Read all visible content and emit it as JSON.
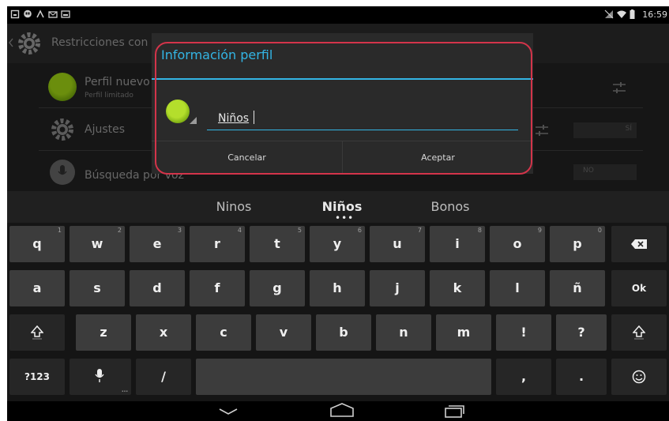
{
  "status_bar": {
    "time": "16:59"
  },
  "settings": {
    "title": "Restricciones con",
    "rows": [
      {
        "title": "Perfil nuevo",
        "subtitle": "Perfil limitado"
      },
      {
        "title": "Ajustes",
        "toggle": "SÍ"
      },
      {
        "title": "Búsqueda por voz",
        "toggle": "NO"
      }
    ]
  },
  "dialog": {
    "title": "Información perfil",
    "name_value": "Niños",
    "cancel_label": "Cancelar",
    "ok_label": "Aceptar"
  },
  "suggestions": {
    "left": "Ninos",
    "center": "Niños",
    "right": "Bonos"
  },
  "keyboard": {
    "row1": [
      {
        "label": "q",
        "hint": "1"
      },
      {
        "label": "w",
        "hint": "2"
      },
      {
        "label": "e",
        "hint": "3"
      },
      {
        "label": "r",
        "hint": "4"
      },
      {
        "label": "t",
        "hint": "5"
      },
      {
        "label": "y",
        "hint": "6"
      },
      {
        "label": "u",
        "hint": "7"
      },
      {
        "label": "i",
        "hint": "8"
      },
      {
        "label": "o",
        "hint": "9"
      },
      {
        "label": "p",
        "hint": "0"
      }
    ],
    "row2": [
      "a",
      "s",
      "d",
      "f",
      "g",
      "h",
      "j",
      "k",
      "l",
      "ñ"
    ],
    "ok_label": "Ok",
    "row3": [
      "z",
      "x",
      "c",
      "v",
      "b",
      "n",
      "m",
      "!",
      "?"
    ],
    "symbols_label": "?123",
    "slash": "/",
    "comma": ",",
    "period": "."
  },
  "colors": {
    "accent": "#33b5e5",
    "highlight_outline": "#d3344a"
  }
}
